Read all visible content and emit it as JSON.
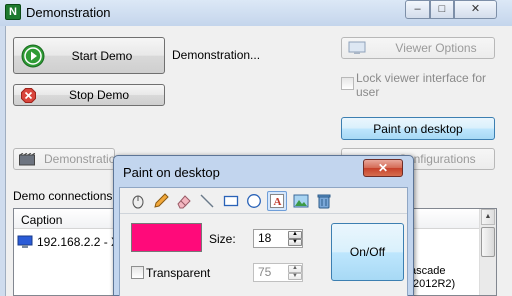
{
  "window": {
    "title": "Demonstration",
    "app_icon_glyph": "N",
    "controls": [
      "–",
      "□",
      "✕"
    ]
  },
  "main": {
    "start_demo": "Start Demo",
    "demo_status": "Demonstration...",
    "stop_demo": "Stop Demo",
    "viewer_options": "Viewer Options",
    "lock_viewer_label": "Lock viewer interface for user",
    "lock_viewer_checked": false,
    "paint_on_desktop": "Paint on desktop",
    "demonstration_button": "Demonstration",
    "configurations_button": "Configurations",
    "demo_connections_label": "Demo connections"
  },
  "connections_list": {
    "header_caption": "Caption",
    "rows": [
      {
        "caption": "192.168.2.2 - X"
      }
    ],
    "partial_text": [
      "ascade",
      "2012R2)"
    ]
  },
  "paint_dialog": {
    "title": "Paint on desktop",
    "close_glyph": "✕",
    "tools": [
      "mouse-pointer-icon",
      "pencil-icon",
      "eraser-icon",
      "line-icon",
      "rectangle-icon",
      "ellipse-icon",
      "text-icon",
      "image-icon",
      "trash-icon"
    ],
    "active_tool": "text-icon",
    "color": "#ff0a7a",
    "size_label": "Size:",
    "size_value": "18",
    "onoff_label": "On/Off",
    "transparent_label": "Transparent",
    "transparent_checked": false,
    "transparency_value": "75"
  },
  "colors": {
    "accent_blue": "#3c7fb1",
    "start_green": "#2e9b35",
    "stop_red": "#d9453c"
  }
}
